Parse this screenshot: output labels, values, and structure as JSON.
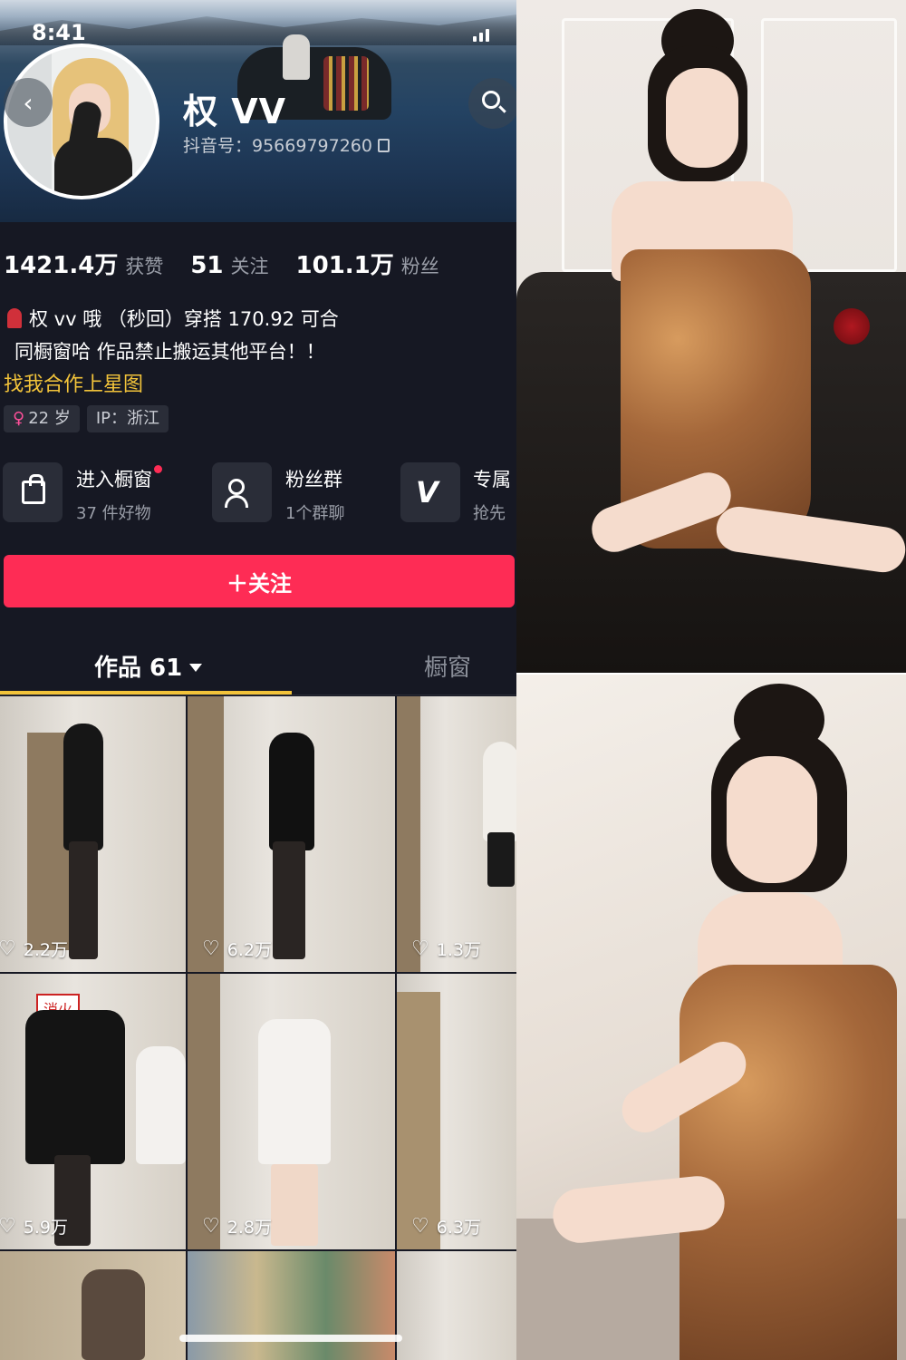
{
  "status_bar": {
    "time": "8:41"
  },
  "profile": {
    "nickname": "权 VV",
    "douyin_id": "抖音号：95669797260",
    "stats": [
      {
        "value": "1421.4万",
        "label": "获赞"
      },
      {
        "value": "51",
        "label": "关注"
      },
      {
        "value": "101.1万",
        "label": "粉丝"
      }
    ],
    "bio_line1": "权 vv 哦 （秒回）穿搭 170.92 可合",
    "bio_line2": "同橱窗哈  作品禁止搬运其他平台！！",
    "collab_link": "找我合作上星图",
    "tags": [
      "22 岁",
      "IP：浙江"
    ],
    "tag_gender_symbol": "♀"
  },
  "shortcuts": [
    {
      "title": "进入橱窗",
      "subtitle": "37 件好物",
      "icon": "shopping-bag-icon"
    },
    {
      "title": "粉丝群",
      "subtitle": "1个群聊",
      "icon": "group-chat-icon"
    },
    {
      "title": "专属",
      "subtitle": "抢先",
      "icon": "v-logo-icon"
    }
  ],
  "follow_button": "＋关注",
  "tabs": {
    "works": "作品 61",
    "shop": "橱窗"
  },
  "videos": [
    {
      "likes": "2.2万"
    },
    {
      "likes": "6.2万"
    },
    {
      "likes": "1.3万"
    },
    {
      "likes": "5.9万"
    },
    {
      "likes": "2.8万"
    },
    {
      "likes": "6.3万"
    }
  ],
  "overlay_texts": {
    "fire_sign": "消火"
  },
  "colors": {
    "accent_red": "#fe2c55",
    "link_yellow": "#f2c33a",
    "background": "#161823"
  }
}
